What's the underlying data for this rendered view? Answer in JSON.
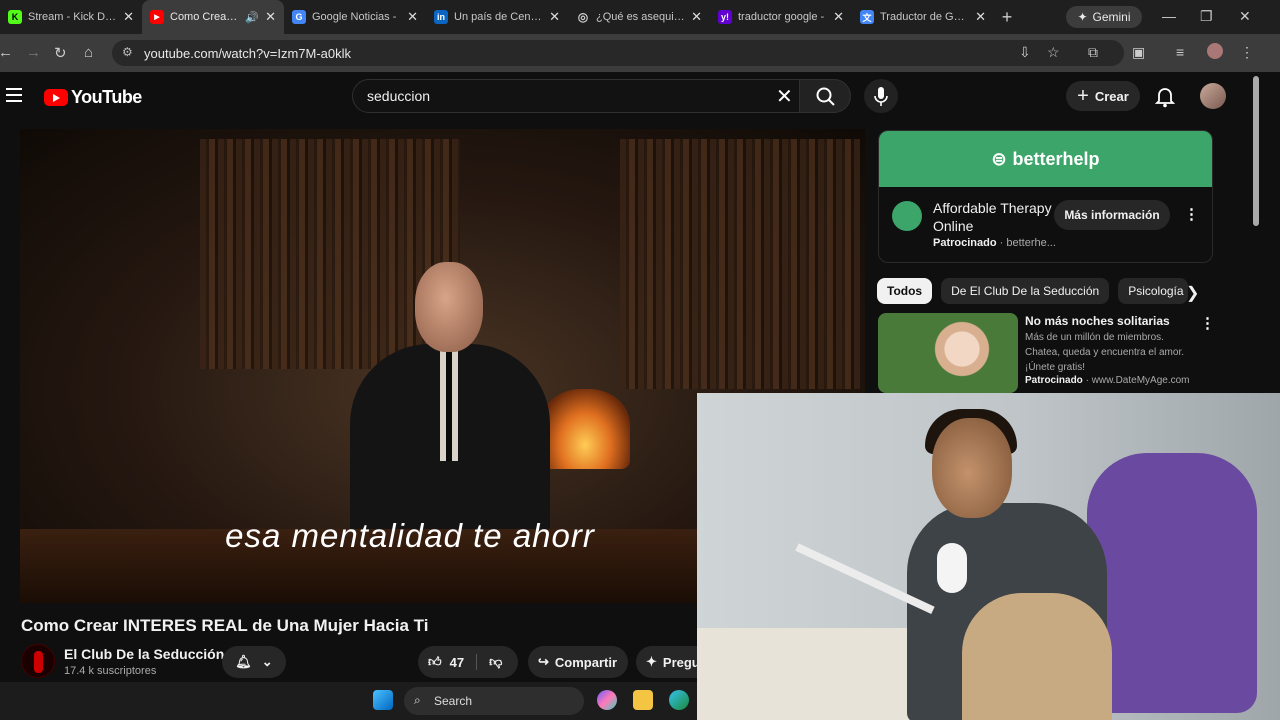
{
  "browser": {
    "tabs": [
      {
        "title": "Stream - Kick Dash",
        "favicon": "K",
        "color": "#53fc18",
        "active": false
      },
      {
        "title": "Como Crear IN",
        "favicon": "▶",
        "color": "#ff0000",
        "active": true
      },
      {
        "title": "Google Noticias -",
        "favicon": "G",
        "color": "#4285f4",
        "active": false
      },
      {
        "title": "Un país de Centro",
        "favicon": "in",
        "color": "#0a66c2",
        "active": false
      },
      {
        "title": "¿Qué es asequibilid",
        "favicon": "◎",
        "color": "#666666",
        "active": false
      },
      {
        "title": "traductor google -",
        "favicon": "y!",
        "color": "#6001d2",
        "active": false
      },
      {
        "title": "Traductor de Goog",
        "favicon": "文",
        "color": "#4285f4",
        "active": false
      }
    ],
    "gemini_label": "Gemini",
    "url": "youtube.com/watch?v=Izm7M-a0klk"
  },
  "youtube": {
    "logo_text": "YouTube",
    "search_value": "seduccion",
    "create_label": "Crear",
    "video": {
      "subtitle": "esa mentalidad te ahorr",
      "title": "Como Crear INTERES REAL de Una Mujer Hacia Ti",
      "channel": "El Club De la Seducción",
      "subscribers": "17.4 k suscriptores",
      "likes": "47",
      "share_label": "Compartir",
      "ask_label": "Pregu"
    },
    "ad": {
      "brand": "betterhelp",
      "title": "Affordable Therapy Online",
      "sponsored": "Patrocinado",
      "domain": "betterhe...",
      "cta": "Más información"
    },
    "chips": [
      "Todos",
      "De El Club De la Seducción",
      "Psicología"
    ],
    "recommendation": {
      "title": "No más noches solitarias",
      "description": "Más de un millón de miembros. Chatea, queda y encuentra el amor. ¡Únete gratis!",
      "sponsored": "Patrocinado",
      "domain": "www.DateMyAge.com"
    }
  },
  "taskbar": {
    "search_label": "Search"
  }
}
